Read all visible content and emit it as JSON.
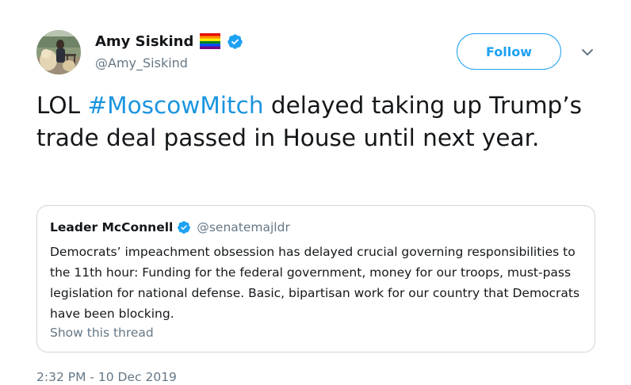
{
  "author": {
    "display_name": "Amy Siskind",
    "handle": "@Amy_Siskind",
    "flag_icon": "rainbow-flag-icon",
    "verified_icon": "verified-badge-icon"
  },
  "actions": {
    "follow_label": "Follow",
    "more_icon": "chevron-down-icon"
  },
  "tweet": {
    "text_prefix": "LOL ",
    "hashtag": "#MoscowMitch",
    "text_suffix": " delayed taking up Trump’s trade deal passed in House until next year.",
    "timestamp": "2:32 PM - 10 Dec 2019"
  },
  "quoted_tweet": {
    "display_name": "Leader McConnell",
    "handle": "@senatemajldr",
    "body": "Democrats’ impeachment obsession has delayed crucial governing responsibilities to the 11th hour: Funding for the federal government, money for our troops, must-pass legislation for national defense. Basic, bipartisan work for our country that Democrats have been blocking.",
    "show_thread_label": "Show this thread"
  },
  "colors": {
    "link_blue": "#1b95e0",
    "follow_blue": "#1da1f2",
    "secondary_text": "#657786",
    "primary_text": "#14171a",
    "border": "#ccd6dd"
  }
}
